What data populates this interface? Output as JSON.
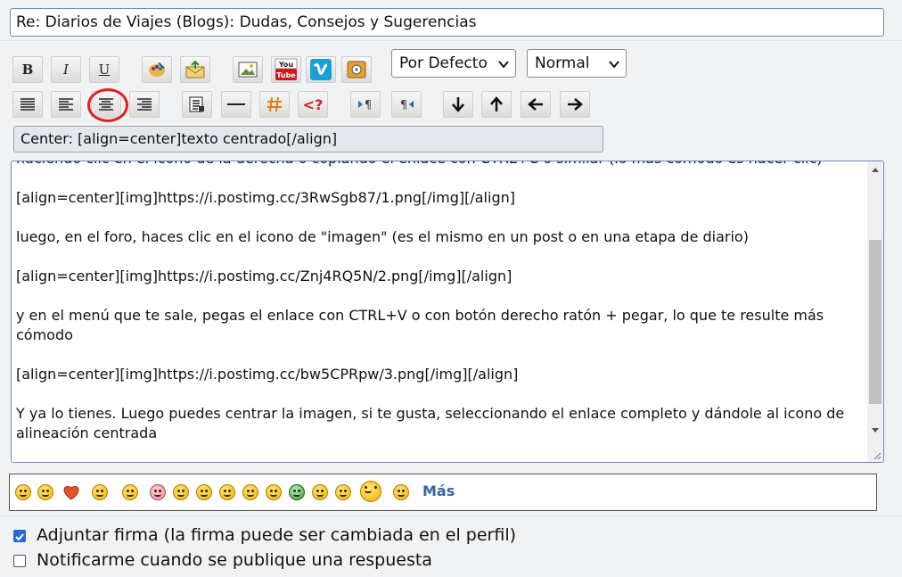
{
  "subject": "Re: Diarios de Viajes (Blogs): Dudas, Consejos y Sugerencias",
  "toolbar": {
    "bold": "B",
    "italic": "I",
    "underline": "U",
    "flag_right": "¶",
    "flag_left": "¶"
  },
  "font_select": {
    "value": "Por Defecto"
  },
  "size_select": {
    "value": "Normal"
  },
  "hint": "Center: [align=center]texto centrado[/align]",
  "editor": {
    "lines": [
      "haciendo clic en el icono de la derecha o copiando el enlace con CTRL+C o similar (lo más cómodo es hacer clic)",
      "",
      "[align=center][img]https://i.postimg.cc/3RwSgb87/1.png[/img][/align]",
      "",
      "luego, en el foro, haces clic en el icono de \"imagen\" (es el mismo en un post o en una etapa de diario)",
      "",
      "[align=center][img]https://i.postimg.cc/Znj4RQ5N/2.png[/img][/align]",
      "",
      "y en el menú que te sale, pegas el enlace con CTRL+V o con botón derecho ratón + pegar, lo que te resulte más cómodo",
      "",
      "[align=center][img]https://i.postimg.cc/bw5CPRpw/3.png[/img][/align]",
      "",
      "Y ya lo tienes. Luego puedes centrar la imagen, si te gusta, seleccionando el enlace completo y dándole al icono de alineación centrada"
    ]
  },
  "smilies": {
    "more_label": "Más"
  },
  "options": {
    "signature_label": "Adjuntar firma (la firma puede ser cambiada en el perfil)",
    "signature_checked": true,
    "notify_label": "Notificarme cuando se publique una respuesta",
    "notify_checked": false
  },
  "colors": {
    "accent": "#2a66cf",
    "highlight": "#e02020",
    "link": "#3465a4"
  }
}
